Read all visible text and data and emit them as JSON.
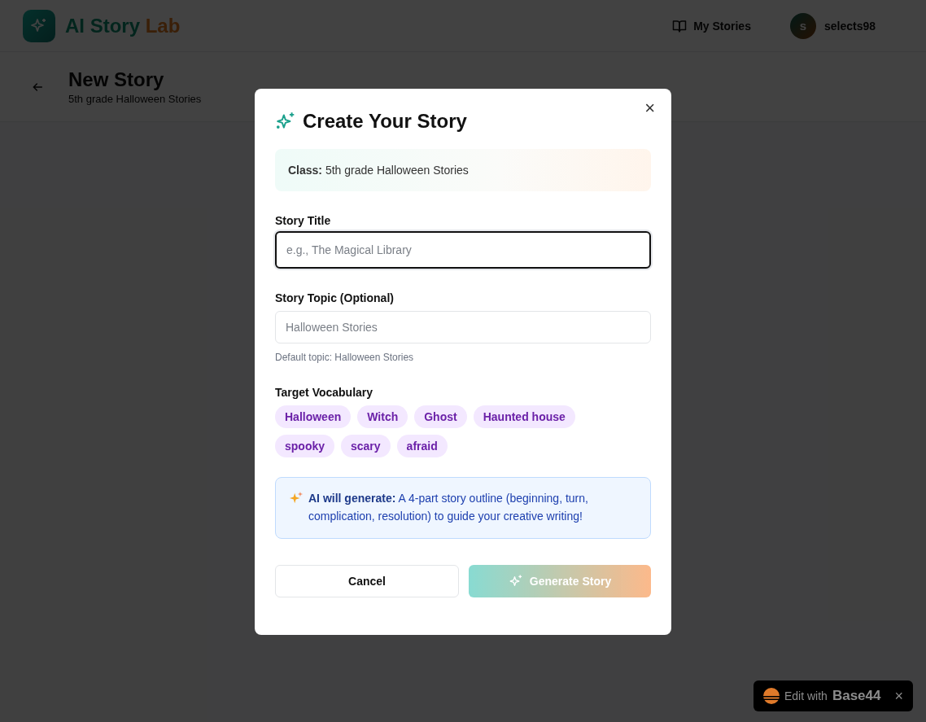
{
  "app": {
    "name_part_1": "AI Story",
    "name_part_2": "Lab"
  },
  "nav": {
    "my_stories": "My Stories",
    "avatar_initial": "s",
    "username": "selects98"
  },
  "page": {
    "title": "New Story",
    "subtitle": "5th grade Halloween Stories"
  },
  "dialog": {
    "title": "Create Your Story",
    "close": "×",
    "class_info": "**Class:** 5th grade Halloween Stories",
    "fields": [
      {
        "label": "Story Title",
        "placeholder": "e.g., The Magical Library",
        "focused": true
      },
      {
        "label": "Story Topic (Optional)",
        "placeholder": "Halloween Stories",
        "focused": false,
        "hint": "Default topic: Halloween Stories"
      }
    ],
    "vocabulary_label": "Target Vocabulary",
    "vocabulary": [
      "Halloween",
      "Witch",
      "Ghost",
      "Haunted house",
      "spooky",
      "scary",
      "afraid"
    ],
    "info": "**AI will generate:** A 4-part story outline (beginning, turn, complication, resolution) to guide your creative writing!",
    "buttons": [
      {
        "kind": "secondary",
        "label": "Cancel",
        "disabled": false
      },
      {
        "kind": "primary",
        "label": "Generate Story",
        "disabled": true
      }
    ]
  },
  "badge": {
    "prefix": "Edit with",
    "brand": "Base44",
    "close": "×"
  }
}
